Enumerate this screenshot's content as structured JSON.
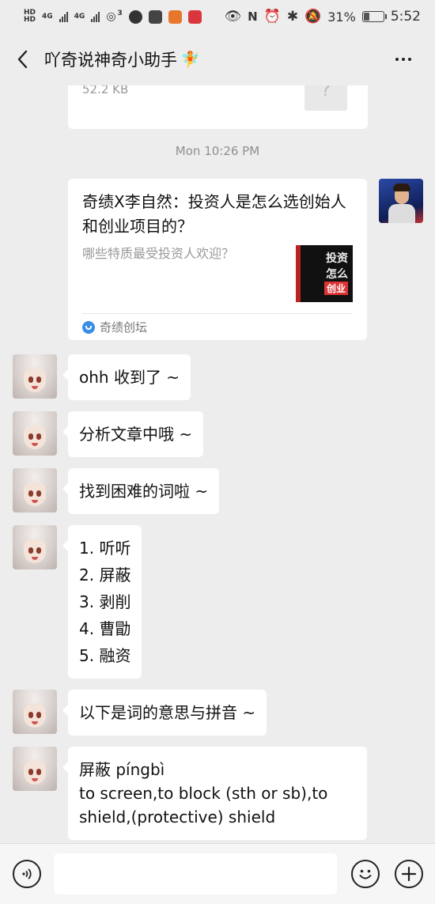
{
  "status_bar": {
    "left_labels": [
      "HD",
      "4G",
      "4G",
      "3"
    ],
    "battery_percent": 31,
    "battery_text": "31%",
    "time": "5:52"
  },
  "header": {
    "title": "吖奇说神奇小助手",
    "title_emoji": "🧚",
    "back_icon": "chevron-left-icon",
    "more_icon": "more-dots-icon"
  },
  "messages": {
    "file_card": {
      "size": "52.2 KB",
      "icon_glyph": "?"
    },
    "timestamp": "Mon 10:26 PM",
    "article": {
      "title": "奇绩X李自然：投资人是怎么选创始人和创业项目的？",
      "description": "哪些特质最受投资人欢迎？",
      "thumb_line1": "投资",
      "thumb_line2": "怎么",
      "thumb_line3": "创业",
      "source": "奇绩创坛"
    },
    "bot_replies": [
      "ohh 收到了 ~",
      "分析文章中哦 ~",
      "找到困难的词啦 ~"
    ],
    "word_list": [
      "1. 听听",
      "2. 屏蔽",
      "3. 剥削",
      "4. 曹勖",
      "5. 融资"
    ],
    "intro": "以下是词的意思与拼音 ~",
    "definition": {
      "word": "屏蔽 píngbì",
      "meaning": "to screen,to block (sth or sb),to shield,(protective) shield"
    }
  },
  "input_bar": {
    "voice_icon": "voice-icon",
    "emoji_icon": "emoji-icon",
    "plus_icon": "plus-icon",
    "placeholder": ""
  }
}
